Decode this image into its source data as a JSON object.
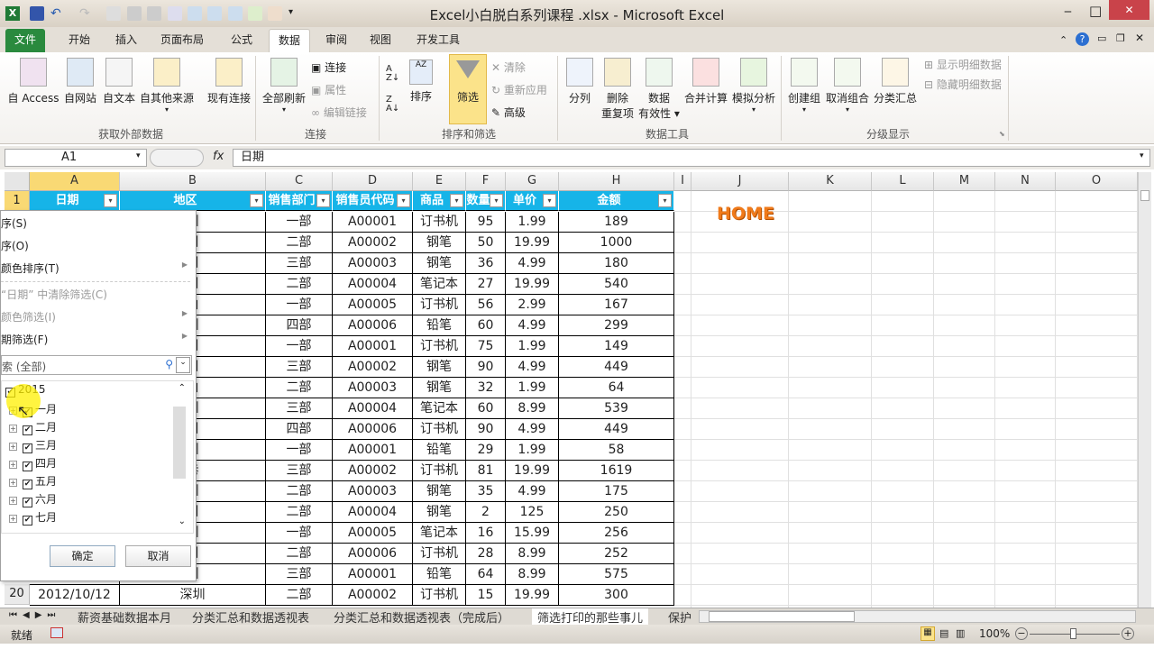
{
  "window": {
    "title": "Excel小白脱白系列课程 .xlsx - Microsoft Excel",
    "minimize": "‒",
    "maximize": "□",
    "close": "✕"
  },
  "ribbon_tabs": [
    "文件",
    "开始",
    "插入",
    "页面布局",
    "公式",
    "数据",
    "审阅",
    "视图",
    "开发工具"
  ],
  "active_tab": "数据",
  "ribbon": {
    "get_external": {
      "items": [
        "自 Access",
        "自网站",
        "自文本",
        "自其他来源",
        "现有连接"
      ],
      "label": "获取外部数据"
    },
    "connections": {
      "refresh": "全部刷新",
      "items": [
        "连接",
        "属性",
        "编辑链接"
      ],
      "label": "连接"
    },
    "sort_filter": {
      "sort": "排序",
      "filter": "筛选",
      "clear": "清除",
      "reapply": "重新应用",
      "advanced": "高级",
      "label": "排序和筛选"
    },
    "data_tools": {
      "items": [
        "分列",
        "删除",
        "重复项",
        "数据",
        "有效性",
        "合并计算",
        "模拟分析"
      ],
      "label": "数据工具"
    },
    "outline": {
      "items": [
        "创建组",
        "取消组合",
        "分类汇总"
      ],
      "show_detail": "显示明细数据",
      "hide_detail": "隐藏明细数据",
      "label": "分级显示"
    }
  },
  "formula_bar": {
    "name_box": "A1",
    "fx": "fx",
    "value": "日期"
  },
  "columns": [
    "A",
    "B",
    "C",
    "D",
    "E",
    "F",
    "G",
    "H",
    "I",
    "J",
    "K",
    "L",
    "M",
    "N",
    "O"
  ],
  "selected_column": "A",
  "headers": [
    "日期",
    "地区",
    "销售部门",
    "销售员代码",
    "商品",
    "数量",
    "单价",
    "金额"
  ],
  "rows": [
    [
      "",
      "圳",
      "一部",
      "A00001",
      "订书机",
      "95",
      "1.99",
      "189"
    ],
    [
      "",
      "州",
      "二部",
      "A00002",
      "钢笔",
      "50",
      "19.99",
      "1000"
    ],
    [
      "",
      "州",
      "三部",
      "A00003",
      "钢笔",
      "36",
      "4.99",
      "180"
    ],
    [
      "",
      "州",
      "二部",
      "A00004",
      "笔记本",
      "27",
      "19.99",
      "540"
    ],
    [
      "",
      "山",
      "一部",
      "A00005",
      "订书机",
      "56",
      "2.99",
      "167"
    ],
    [
      "",
      "圳",
      "四部",
      "A00006",
      "铅笔",
      "60",
      "4.99",
      "299"
    ],
    [
      "",
      "州",
      "一部",
      "A00001",
      "订书机",
      "75",
      "1.99",
      "149"
    ],
    [
      "",
      "州",
      "三部",
      "A00002",
      "钢笔",
      "90",
      "4.99",
      "449"
    ],
    [
      "",
      "山",
      "二部",
      "A00003",
      "钢笔",
      "32",
      "1.99",
      "64"
    ],
    [
      "",
      "圳",
      "三部",
      "A00004",
      "笔记本",
      "60",
      "8.99",
      "539"
    ],
    [
      "",
      "州",
      "四部",
      "A00006",
      "订书机",
      "90",
      "4.99",
      "449"
    ],
    [
      "",
      "圳",
      "一部",
      "A00001",
      "铅笔",
      "29",
      "1.99",
      "58"
    ],
    [
      "",
      "巷",
      "三部",
      "A00002",
      "订书机",
      "81",
      "19.99",
      "1619"
    ],
    [
      "",
      "圳",
      "二部",
      "A00003",
      "钢笔",
      "35",
      "4.99",
      "175"
    ],
    [
      "",
      "州",
      "二部",
      "A00004",
      "钢笔",
      "2",
      "125",
      "250"
    ],
    [
      "",
      "圳",
      "一部",
      "A00005",
      "笔记本",
      "16",
      "15.99",
      "256"
    ],
    [
      "",
      "州",
      "二部",
      "A00006",
      "订书机",
      "28",
      "8.99",
      "252"
    ],
    [
      "",
      "圳",
      "三部",
      "A00001",
      "铅笔",
      "64",
      "8.99",
      "575"
    ],
    [
      "2012/10/12",
      "深圳",
      "二部",
      "A00002",
      "订书机",
      "15",
      "19.99",
      "300"
    ]
  ],
  "row_numbers": {
    "first": "1",
    "last": "20"
  },
  "home_text": "HOME",
  "filter_menu": {
    "items": [
      {
        "label": "序(S)",
        "arrow": false,
        "disabled": false
      },
      {
        "label": "序(O)",
        "arrow": false,
        "disabled": false
      },
      {
        "label": "颜色排序(T)",
        "arrow": true,
        "disabled": false
      },
      {
        "label": "“日期” 中清除筛选(C)",
        "arrow": false,
        "disabled": true
      },
      {
        "label": "颜色筛选(I)",
        "arrow": true,
        "disabled": true
      },
      {
        "label": "期筛选(F)",
        "arrow": true,
        "disabled": false
      }
    ],
    "search_placeholder": "索 (全部)",
    "year": "2015",
    "months": [
      "一月",
      "二月",
      "三月",
      "四月",
      "五月",
      "六月",
      "七月"
    ],
    "ok": "确定",
    "cancel": "取消"
  },
  "sheet_tabs": [
    "薪资基础数据本月",
    "分类汇总和数据透视表",
    "分类汇总和数据透视表（完成后）",
    "筛选打印的那些事儿",
    "保护"
  ],
  "active_sheet": "筛选打印的那些事儿",
  "status": {
    "ready": "就绪",
    "zoom": "100%"
  },
  "colors": {
    "header_fill": "#16b4e8",
    "file_tab": "#2a8a3e",
    "selected_col": "#f9d974",
    "home": "#f07a1a"
  }
}
